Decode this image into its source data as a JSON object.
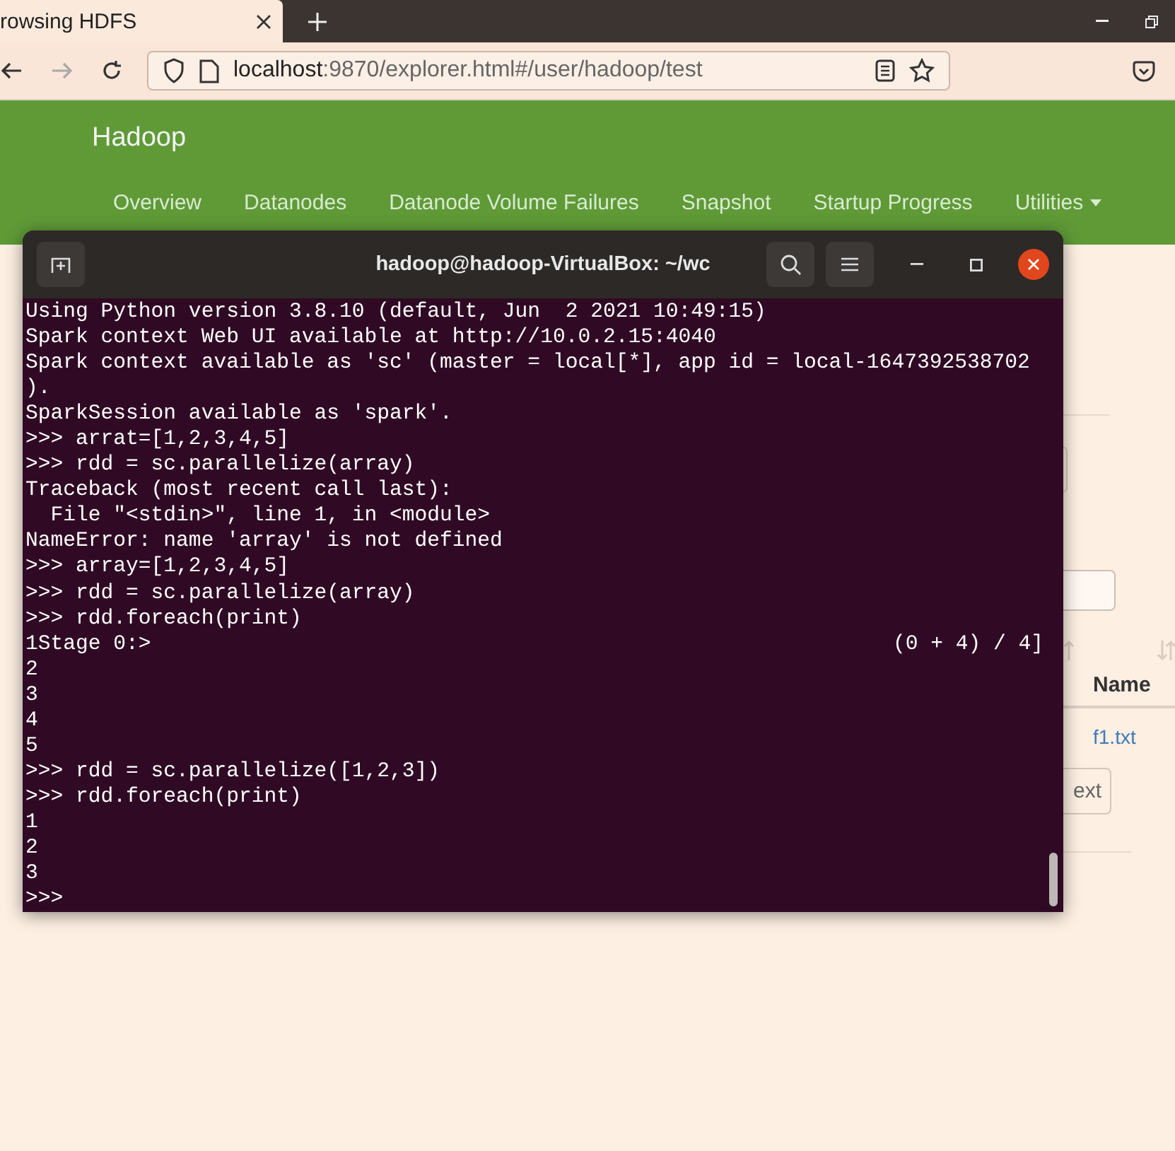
{
  "browser": {
    "tab_title": "rowsing HDFS",
    "url_host": "localhost",
    "url_path": ":9870/explorer.html#/user/hadoop/test"
  },
  "navbar": {
    "brand": "Hadoop",
    "items": [
      {
        "label": "Overview",
        "kind": "link"
      },
      {
        "label": "Datanodes",
        "kind": "link"
      },
      {
        "label": "Datanode Volume Failures",
        "kind": "link"
      },
      {
        "label": "Snapshot",
        "kind": "link"
      },
      {
        "label": "Startup Progress",
        "kind": "link"
      },
      {
        "label": "Utilities",
        "kind": "dropdown"
      }
    ]
  },
  "page": {
    "table_header": "Name",
    "file_link": "f1.txt",
    "button": "ext"
  },
  "terminal": {
    "title": "hadoop@hadoop-VirtualBox: ~/wc",
    "lines": [
      {
        "kind": "text",
        "text": "Using Python version 3.8.10 (default, Jun  2 2021 10:49:15)"
      },
      {
        "kind": "text",
        "text": "Spark context Web UI available at http://10.0.2.15:4040"
      },
      {
        "kind": "text",
        "text": "Spark context available as 'sc' (master = local[*], app id = local-1647392538702"
      },
      {
        "kind": "text",
        "text": ")."
      },
      {
        "kind": "text",
        "text": "SparkSession available as 'spark'."
      },
      {
        "kind": "text",
        "text": ">>> arrat=[1,2,3,4,5]"
      },
      {
        "kind": "text",
        "text": ">>> rdd = sc.parallelize(array)"
      },
      {
        "kind": "text",
        "text": "Traceback (most recent call last):"
      },
      {
        "kind": "text",
        "text": "  File \"<stdin>\", line 1, in <module>"
      },
      {
        "kind": "text",
        "text": "NameError: name 'array' is not defined"
      },
      {
        "kind": "text",
        "text": ">>> array=[1,2,3,4,5]"
      },
      {
        "kind": "text",
        "text": ">>> rdd = sc.parallelize(array)"
      },
      {
        "kind": "text",
        "text": ">>> rdd.foreach(print)"
      },
      {
        "kind": "progress",
        "text": "1Stage 0:>",
        "right": "(0 + 4) / 4]"
      },
      {
        "kind": "text",
        "text": "2"
      },
      {
        "kind": "text",
        "text": "3"
      },
      {
        "kind": "text",
        "text": "4"
      },
      {
        "kind": "text",
        "text": "5"
      },
      {
        "kind": "text",
        "text": ">>> rdd = sc.parallelize([1,2,3])"
      },
      {
        "kind": "text",
        "text": ">>> rdd.foreach(print)"
      },
      {
        "kind": "text",
        "text": "1"
      },
      {
        "kind": "text",
        "text": "2"
      },
      {
        "kind": "text",
        "text": "3"
      },
      {
        "kind": "text",
        "text": ">>>"
      }
    ]
  }
}
